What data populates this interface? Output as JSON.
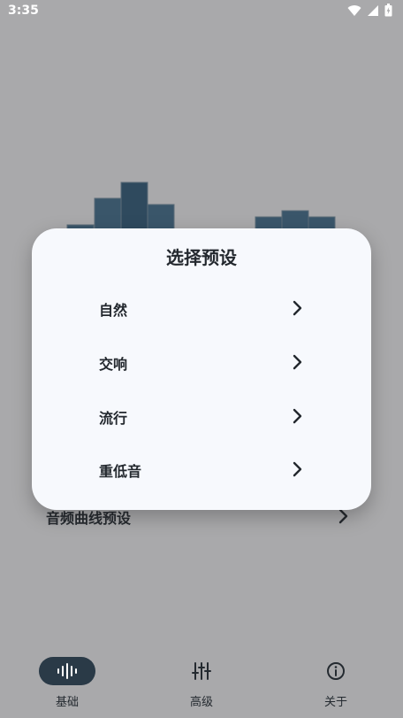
{
  "status_bar": {
    "time": "3:35",
    "icons": [
      "wifi-icon",
      "signal-icon",
      "battery-icon"
    ]
  },
  "background": {
    "preset_row_label": "音频曲线预设"
  },
  "dialog": {
    "title": "选择预设",
    "options": [
      {
        "label": "自然"
      },
      {
        "label": "交响"
      },
      {
        "label": "流行"
      },
      {
        "label": "重低音"
      }
    ]
  },
  "bottom_nav": {
    "items": [
      {
        "label": "基础",
        "icon": "waveform-icon",
        "active": true
      },
      {
        "label": "高级",
        "icon": "sliders-icon",
        "active": false
      },
      {
        "label": "关于",
        "icon": "info-icon",
        "active": false
      }
    ]
  },
  "colors": {
    "scrim": "#a9a9ab",
    "dialog_bg": "#f7f9fd",
    "accent": "#2a3a47",
    "bar_fill": "#3a566a"
  }
}
